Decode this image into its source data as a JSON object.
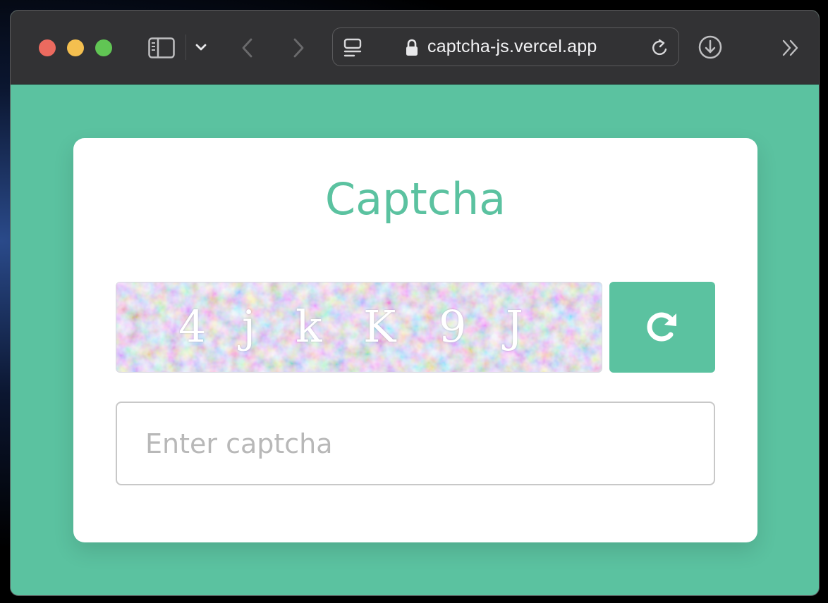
{
  "browser": {
    "url": "captcha-js.vercel.app"
  },
  "card": {
    "title": "Captcha"
  },
  "captcha": {
    "chars": [
      "4",
      "j",
      "k",
      "K",
      "9",
      "J"
    ]
  },
  "input": {
    "placeholder": "Enter captcha",
    "value": ""
  },
  "colors": {
    "accent": "#5bc2a0",
    "toolbar": "#323234"
  },
  "icons": {
    "sidebar": "sidebar-icon",
    "chevron": "chevron-down-icon",
    "back": "back-icon",
    "forward": "forward-icon",
    "reader": "reader-icon",
    "lock": "lock-icon",
    "reload": "reload-icon",
    "download": "download-icon",
    "more": "more-icon",
    "refresh": "refresh-icon"
  }
}
